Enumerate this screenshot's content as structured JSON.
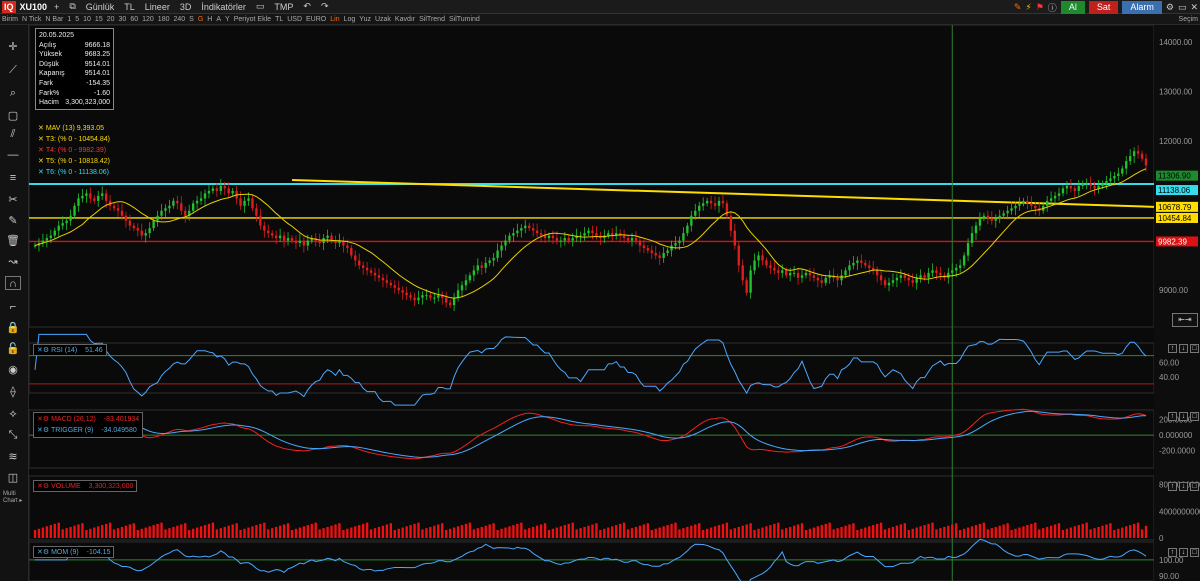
{
  "app": {
    "logo": "IQ",
    "symbol": "XU100",
    "period": "Günlük",
    "currency": "TL",
    "scale": "Lineer",
    "mode3d": "3D",
    "indicators": "İndikatörler",
    "tmp": "TMP",
    "buy": "Al",
    "sell": "Sat",
    "alarm": "Alarm",
    "selection": "Seçim"
  },
  "toolbar2": [
    "Birim",
    "N Tick",
    "N Bar",
    "1",
    "5",
    "10",
    "15",
    "20",
    "30",
    "60",
    "120",
    "180",
    "240",
    "S",
    "G",
    "H",
    "A",
    "Y",
    "Periyot Ekle",
    "TL",
    "USD",
    "EURO",
    "Lin",
    "Log",
    "Yuz",
    "Uzak",
    "Kavdır",
    "SilTrend",
    "SilTumind"
  ],
  "toolbar2_active": [
    "G",
    "Lin"
  ],
  "info": {
    "date": "20.05.2025",
    "rows": [
      [
        "Açılış",
        "9666.18"
      ],
      [
        "Yüksek",
        "9683.25"
      ],
      [
        "Düşük",
        "9514.01"
      ],
      [
        "Kapanış",
        "9514.01"
      ],
      [
        "Fark",
        "-154.35"
      ],
      [
        "Fark%",
        "-1.60"
      ],
      [
        "Hacim",
        "3,300,323,000"
      ]
    ]
  },
  "legend": [
    {
      "text": "MAV (13)  9,393.05",
      "color": "#ffdd00"
    },
    {
      "text": "T3: (% 0 - 10454.84)",
      "color": "#ffdd00"
    },
    {
      "text": "T4: (% 0 - 9982.39)",
      "color": "#ff3333"
    },
    {
      "text": "T5: (% 0 - 10818.42)",
      "color": "#ffdd00"
    },
    {
      "text": "T6: (% 0 - 11138.06)",
      "color": "#33ddee"
    }
  ],
  "panels": {
    "rsi": {
      "label": "RSI (14)",
      "value": "51.46"
    },
    "macd": {
      "label": "MACD (26,12)",
      "value": "-83.401934",
      "trigger_label": "TRIGGER (9)",
      "trigger_value": "-34.049580"
    },
    "volume": {
      "label": "VOLUME",
      "value": "3,300,323,000"
    },
    "mom": {
      "label": "MOM (9)",
      "value": "-104.15"
    }
  },
  "axis": {
    "main": [
      "14000.00",
      "13000.00",
      "12000.00",
      "11000.00",
      "9000.00"
    ],
    "rsi": [
      "60.00",
      "40.00"
    ],
    "macd": [
      "200.0000",
      "0.000000",
      "-200.0000"
    ],
    "volume": [
      "8000000000",
      "4000000000",
      "0"
    ],
    "mom": [
      "100.00",
      "90.00"
    ]
  },
  "price_tags": [
    {
      "value": "11306.90",
      "color": "#1e8a2e"
    },
    {
      "value": "11138.06",
      "color": "#33ddee"
    },
    {
      "value": "10678.79",
      "color": "#ffdd00"
    },
    {
      "value": "10454.84",
      "color": "#ffdd00"
    },
    {
      "value": "9982.39",
      "color": "#dd1111"
    }
  ],
  "colors": {
    "up": "#22c22e",
    "down": "#e01e1e",
    "mav": "#e6d000",
    "cyan": "#33ddee",
    "yellow": "#ffdd00",
    "red": "#dd1111",
    "green": "#2a8a2a"
  },
  "chart_data": {
    "type": "candlestick",
    "ylim": [
      8300,
      14300
    ],
    "x": [
      "c0",
      "c1",
      "c2",
      "c3",
      "c4",
      "c5",
      "c6",
      "c7",
      "c8",
      "c9",
      "c10",
      "c11",
      "c12",
      "c13",
      "c14",
      "c15",
      "c16",
      "c17",
      "c18",
      "c19",
      "c20",
      "c21",
      "c22",
      "c23",
      "c24",
      "c25",
      "c26",
      "c27",
      "c28",
      "c29",
      "c30",
      "c31",
      "c32",
      "c33",
      "c34",
      "c35",
      "c36",
      "c37",
      "c38",
      "c39",
      "c40",
      "c41",
      "c42",
      "c43",
      "c44",
      "c45",
      "c46",
      "c47",
      "c48",
      "c49",
      "c50",
      "c51",
      "c52",
      "c53",
      "c54",
      "c55",
      "c56",
      "c57",
      "c58",
      "c59",
      "c60",
      "c61",
      "c62",
      "c63",
      "c64",
      "c65",
      "c66",
      "c67",
      "c68",
      "c69",
      "c70",
      "c71",
      "c72",
      "c73",
      "c74",
      "c75",
      "c76",
      "c77",
      "c78",
      "c79",
      "c80",
      "c81",
      "c82",
      "c83",
      "c84",
      "c85",
      "c86",
      "c87",
      "c88",
      "c89",
      "c90",
      "c91",
      "c92",
      "c93",
      "c94",
      "c95",
      "c96",
      "c97",
      "c98",
      "c99",
      "c100",
      "c101",
      "c102",
      "c103",
      "c104",
      "c105",
      "c106",
      "c107",
      "c108",
      "c109",
      "c110",
      "c111",
      "c112",
      "c113",
      "c114",
      "c115",
      "c116",
      "c117",
      "c118",
      "c119",
      "c120",
      "c121",
      "c122",
      "c123",
      "c124",
      "c125",
      "c126",
      "c127",
      "c128",
      "c129",
      "c130",
      "c131",
      "c132",
      "c133",
      "c134",
      "c135",
      "c136",
      "c137",
      "c138",
      "c139",
      "c140",
      "c141",
      "c142",
      "c143",
      "c144",
      "c145",
      "c146",
      "c147",
      "c148",
      "c149",
      "c150",
      "c151",
      "c152",
      "c153",
      "c154",
      "c155",
      "c156",
      "c157",
      "c158",
      "c159",
      "c160",
      "c161",
      "c162",
      "c163",
      "c164",
      "c165",
      "c166",
      "c167",
      "c168",
      "c169",
      "c170",
      "c171",
      "c172",
      "c173",
      "c174",
      "c175",
      "c176",
      "c177",
      "c178",
      "c179",
      "c180",
      "c181",
      "c182",
      "c183",
      "c184",
      "c185",
      "c186",
      "c187",
      "c188",
      "c189",
      "c190",
      "c191",
      "c192",
      "c193",
      "c194",
      "c195",
      "c196",
      "c197",
      "c198",
      "c199",
      "c200",
      "c201",
      "c202",
      "c203",
      "c204",
      "c205",
      "c206",
      "c207",
      "c208",
      "c209",
      "c210",
      "c211",
      "c212",
      "c213",
      "c214",
      "c215",
      "c216",
      "c217",
      "c218",
      "c219",
      "c220",
      "c221",
      "c222",
      "c223",
      "c224",
      "c225",
      "c226",
      "c227",
      "c228",
      "c229",
      "c230",
      "c231",
      "c232",
      "c233",
      "c234",
      "c235",
      "c236",
      "c237",
      "c238",
      "c239",
      "c240",
      "c241",
      "c242",
      "c243",
      "c244",
      "c245",
      "c246",
      "c247",
      "c248",
      "c249",
      "c250",
      "c251",
      "c252",
      "c253",
      "c254",
      "c255",
      "c256",
      "c257",
      "c258",
      "c259",
      "c260",
      "c261",
      "c262",
      "c263",
      "c264",
      "c265",
      "c266",
      "c267",
      "c268",
      "c269",
      "c270",
      "c271",
      "c272",
      "c273",
      "c274",
      "c275",
      "c276",
      "c277",
      "c278",
      "c279",
      "c280",
      "c281",
      "c282",
      "c283",
      "c284",
      "c285",
      "c286",
      "c287",
      "c288",
      "c289",
      "c290",
      "c291",
      "c292",
      "c293",
      "c294",
      "c295",
      "c296",
      "c297",
      "c298",
      "c299"
    ],
    "close": [
      9900,
      9950,
      10000,
      10050,
      10100,
      10200,
      10300,
      10350,
      10400,
      10500,
      10700,
      10850,
      10900,
      10950,
      10850,
      10800,
      10900,
      10950,
      10800,
      10700,
      10650,
      10600,
      10500,
      10400,
      10300,
      10250,
      10200,
      10100,
      10150,
      10250,
      10400,
      10500,
      10600,
      10650,
      10700,
      10800,
      10750,
      10600,
      10500,
      10600,
      10750,
      10800,
      10850,
      10950,
      11000,
      11050,
      11000,
      11100,
      11050,
      10950,
      11000,
      10850,
      10700,
      10800,
      10850,
      10650,
      10500,
      10300,
      10200,
      10150,
      10100,
      10050,
      10100,
      10000,
      10050,
      10000,
      9950,
      10000,
      9900,
      10000,
      10050,
      10000,
      9950,
      10050,
      10100,
      10000,
      9950,
      10000,
      9900,
      9850,
      9700,
      9600,
      9500,
      9450,
      9400,
      9350,
      9300,
      9250,
      9200,
      9150,
      9100,
      9050,
      9000,
      8950,
      8900,
      8850,
      8800,
      8850,
      8900,
      8900,
      8850,
      8850,
      8900,
      8850,
      8750,
      8700,
      8850,
      9000,
      9100,
      9200,
      9300,
      9400,
      9500,
      9450,
      9550,
      9600,
      9650,
      9800,
      9900,
      10000,
      10100,
      10150,
      10200,
      10250,
      10300,
      10250,
      10200,
      10150,
      10100,
      10050,
      10100,
      10050,
      10000,
      10000,
      10050,
      10000,
      10050,
      10100,
      10100,
      10150,
      10200,
      10150,
      10100,
      10050,
      10100,
      10150,
      10100,
      10150,
      10100,
      10050,
      10000,
      10050,
      10000,
      9900,
      9850,
      9800,
      9750,
      9700,
      9650,
      9750,
      9800,
      9900,
      9950,
      10000,
      10150,
      10300,
      10500,
      10600,
      10700,
      10750,
      10800,
      10750,
      10700,
      10800,
      10750,
      10500,
      10200,
      9900,
      9500,
      9200,
      8950,
      9400,
      9600,
      9700,
      9600,
      9500,
      9450,
      9400,
      9350,
      9400,
      9300,
      9350,
      9350,
      9250,
      9300,
      9350,
      9300,
      9250,
      9200,
      9150,
      9250,
      9300,
      9250,
      9200,
      9300,
      9400,
      9500,
      9550,
      9600,
      9550,
      9500,
      9450,
      9400,
      9300,
      9200,
      9100,
      9150,
      9200,
      9250,
      9300,
      9250,
      9200,
      9150,
      9250,
      9300,
      9250,
      9350,
      9400,
      9350,
      9300,
      9250,
      9350,
      9400,
      9450,
      9500,
      9700,
      9950,
      10150,
      10300,
      10450,
      10500,
      10450,
      10400,
      10450,
      10500,
      10550,
      10600,
      10650,
      10700,
      10750,
      10800,
      10750,
      10700,
      10650,
      10600,
      10700,
      10800,
      10850,
      10900,
      10950,
      11050,
      11100,
      11050,
      11000,
      11100,
      11150,
      11150,
      11100,
      11050,
      11100,
      11150,
      11200,
      11250,
      11300,
      11350,
      11450,
      11600,
      11700,
      11800,
      11750,
      11650,
      11514
    ]
  }
}
